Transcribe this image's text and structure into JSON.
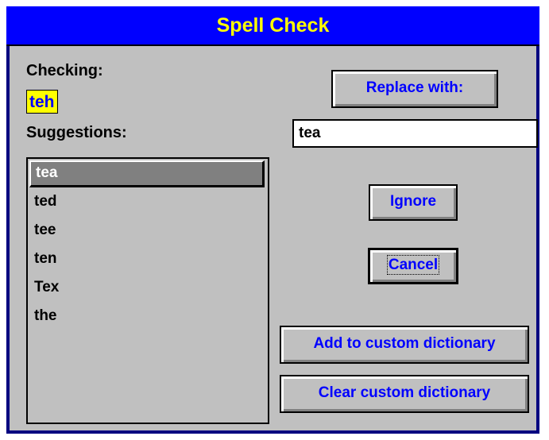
{
  "dialog": {
    "title": "Spell Check",
    "checking_label": "Checking:",
    "checking_word": "teh",
    "suggestions_label": "Suggestions:",
    "suggestions": [
      "tea",
      "ted",
      "tee",
      "ten",
      "Tex",
      "the"
    ],
    "selected_suggestion": "tea",
    "replace_value": "tea",
    "buttons": {
      "replace_with": "Replace with:",
      "ignore": "Ignore",
      "cancel": "Cancel",
      "add_custom": "Add to custom dictionary",
      "clear_custom": "Clear custom dictionary"
    }
  },
  "colors": {
    "title_bar": "#0000ff",
    "title_text": "#ffff00",
    "frame": "#000080",
    "face": "#c0c0c0",
    "button_text": "#0000ff",
    "highlight_word_bg": "#ffff00",
    "selection": "#808080"
  }
}
